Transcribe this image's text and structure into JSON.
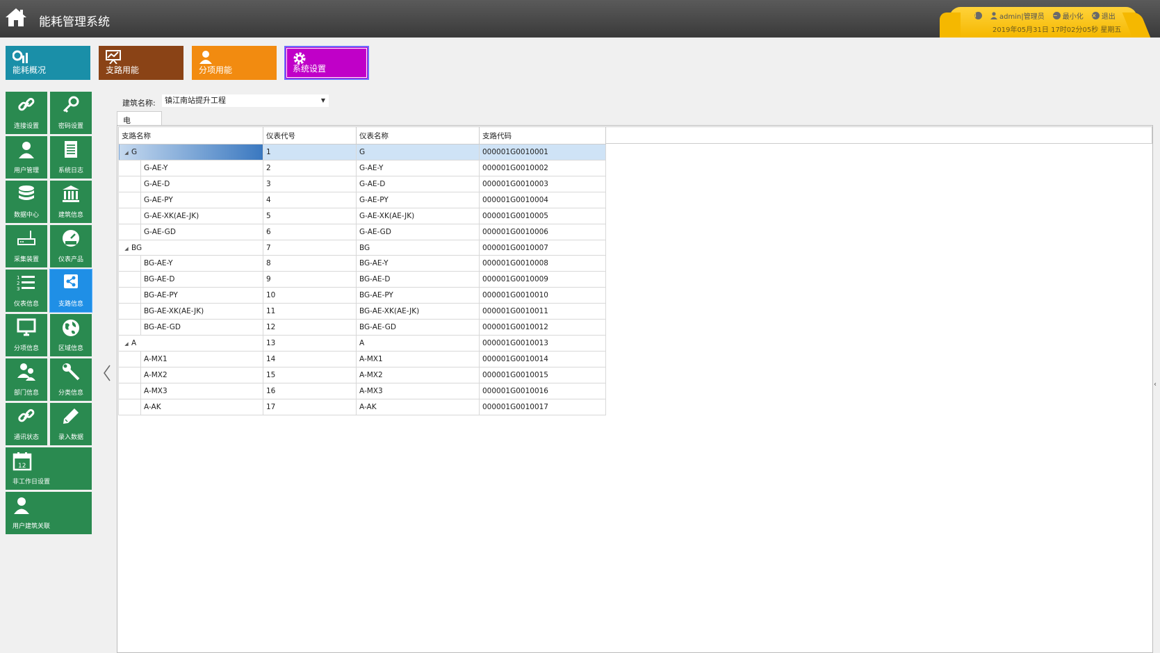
{
  "header": {
    "app_title": "能耗管理系统",
    "user": "admin|管理员",
    "minimize": "最小化",
    "logout": "退出",
    "datetime": "2019年05月31日 17时02分05秒 星期五",
    "panel_color": "#f5b800"
  },
  "modules": [
    {
      "label": "能耗概况",
      "color": "#1a8fa8",
      "icon": "energy-chart-icon"
    },
    {
      "label": "支路用能",
      "color": "#8a4316",
      "icon": "branch-chart-icon"
    },
    {
      "label": "分项用能",
      "color": "#f28b10",
      "icon": "person-icon"
    },
    {
      "label": "系统设置",
      "color": "#c000c8",
      "icon": "gear-icon",
      "selected": true
    }
  ],
  "side_menu": [
    {
      "label": "连接设置",
      "icon": "link-icon"
    },
    {
      "label": "密码设置",
      "icon": "key-icon"
    },
    {
      "label": "用户管理",
      "icon": "user-icon"
    },
    {
      "label": "系统日志",
      "icon": "log-icon"
    },
    {
      "label": "数据中心",
      "icon": "database-icon"
    },
    {
      "label": "建筑信息",
      "icon": "building-icon"
    },
    {
      "label": "采集装置",
      "icon": "router-icon"
    },
    {
      "label": "仪表产品",
      "icon": "gauge-icon"
    },
    {
      "label": "仪表信息",
      "icon": "list-icon"
    },
    {
      "label": "支路信息",
      "icon": "share-icon",
      "active": true
    },
    {
      "label": "分项信息",
      "icon": "monitor-icon"
    },
    {
      "label": "区域信息",
      "icon": "globe-icon"
    },
    {
      "label": "部门信息",
      "icon": "users-icon"
    },
    {
      "label": "分类信息",
      "icon": "wrench-icon"
    },
    {
      "label": "通讯状态",
      "icon": "link-icon"
    },
    {
      "label": "录入数据",
      "icon": "pencil-icon"
    },
    {
      "label": "非工作日设置",
      "icon": "calendar-icon"
    },
    {
      "label": "用户建筑关联",
      "icon": "user-icon"
    }
  ],
  "content": {
    "building_label": "建筑名称:",
    "building_value": "镇江南站提升工程",
    "tab": "电",
    "columns": [
      "支路名称",
      "仪表代号",
      "仪表名称",
      "支路代码"
    ],
    "rows": [
      {
        "name": "G",
        "level": 0,
        "no": "1",
        "meter": "G",
        "code": "000001G0010001",
        "selected": true
      },
      {
        "name": "G-AE-Y",
        "level": 1,
        "no": "2",
        "meter": "G-AE-Y",
        "code": "000001G0010002"
      },
      {
        "name": "G-AE-D",
        "level": 1,
        "no": "3",
        "meter": "G-AE-D",
        "code": "000001G0010003"
      },
      {
        "name": "G-AE-PY",
        "level": 1,
        "no": "4",
        "meter": "G-AE-PY",
        "code": "000001G0010004"
      },
      {
        "name": "G-AE-XK(AE-JK)",
        "level": 1,
        "no": "5",
        "meter": "G-AE-XK(AE-JK)",
        "code": "000001G0010005"
      },
      {
        "name": "G-AE-GD",
        "level": 1,
        "no": "6",
        "meter": "G-AE-GD",
        "code": "000001G0010006"
      },
      {
        "name": "BG",
        "level": 0,
        "no": "7",
        "meter": "BG",
        "code": "000001G0010007"
      },
      {
        "name": "BG-AE-Y",
        "level": 1,
        "no": "8",
        "meter": "BG-AE-Y",
        "code": "000001G0010008"
      },
      {
        "name": "BG-AE-D",
        "level": 1,
        "no": "9",
        "meter": "BG-AE-D",
        "code": "000001G0010009"
      },
      {
        "name": "BG-AE-PY",
        "level": 1,
        "no": "10",
        "meter": "BG-AE-PY",
        "code": "000001G0010010"
      },
      {
        "name": "BG-AE-XK(AE-JK)",
        "level": 1,
        "no": "11",
        "meter": "BG-AE-XK(AE-JK)",
        "code": "000001G0010011"
      },
      {
        "name": "BG-AE-GD",
        "level": 1,
        "no": "12",
        "meter": "BG-AE-GD",
        "code": "000001G0010012"
      },
      {
        "name": "A",
        "level": 0,
        "no": "13",
        "meter": "A",
        "code": "000001G0010013"
      },
      {
        "name": "A-MX1",
        "level": 1,
        "no": "14",
        "meter": "A-MX1",
        "code": "000001G0010014"
      },
      {
        "name": "A-MX2",
        "level": 1,
        "no": "15",
        "meter": "A-MX2",
        "code": "000001G0010015"
      },
      {
        "name": "A-MX3",
        "level": 1,
        "no": "16",
        "meter": "A-MX3",
        "code": "000001G0010016"
      },
      {
        "name": "A-AK",
        "level": 1,
        "no": "17",
        "meter": "A-AK",
        "code": "000001G0010017"
      }
    ]
  }
}
